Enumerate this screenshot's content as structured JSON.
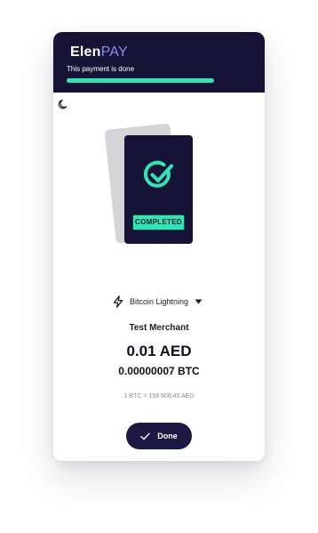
{
  "brand": {
    "name_part1": "Elen",
    "name_part2": "PAY"
  },
  "header": {
    "status_text": "This payment is done",
    "progress": 1.0
  },
  "theme_toggle": {
    "icon": "moon-icon"
  },
  "status_card": {
    "icon": "check-circle-icon",
    "badge": "COMPLETED"
  },
  "network": {
    "icon": "lightning-bolt-icon",
    "label": "Bitcoin Lightning",
    "dropdown_icon": "caret-down-icon"
  },
  "payment": {
    "merchant": "Test Merchant",
    "amount_fiat": "0.01 AED",
    "amount_crypto": "0.00000007 BTC",
    "rate": "1 BTC = 158 908.45 AED"
  },
  "actions": {
    "done_label": "Done",
    "done_icon": "check-icon"
  },
  "colors": {
    "header_bg": "#171337",
    "accent": "#2ee6b6",
    "logo_accent": "#8b8ff7",
    "button_bg": "#1c1844"
  }
}
